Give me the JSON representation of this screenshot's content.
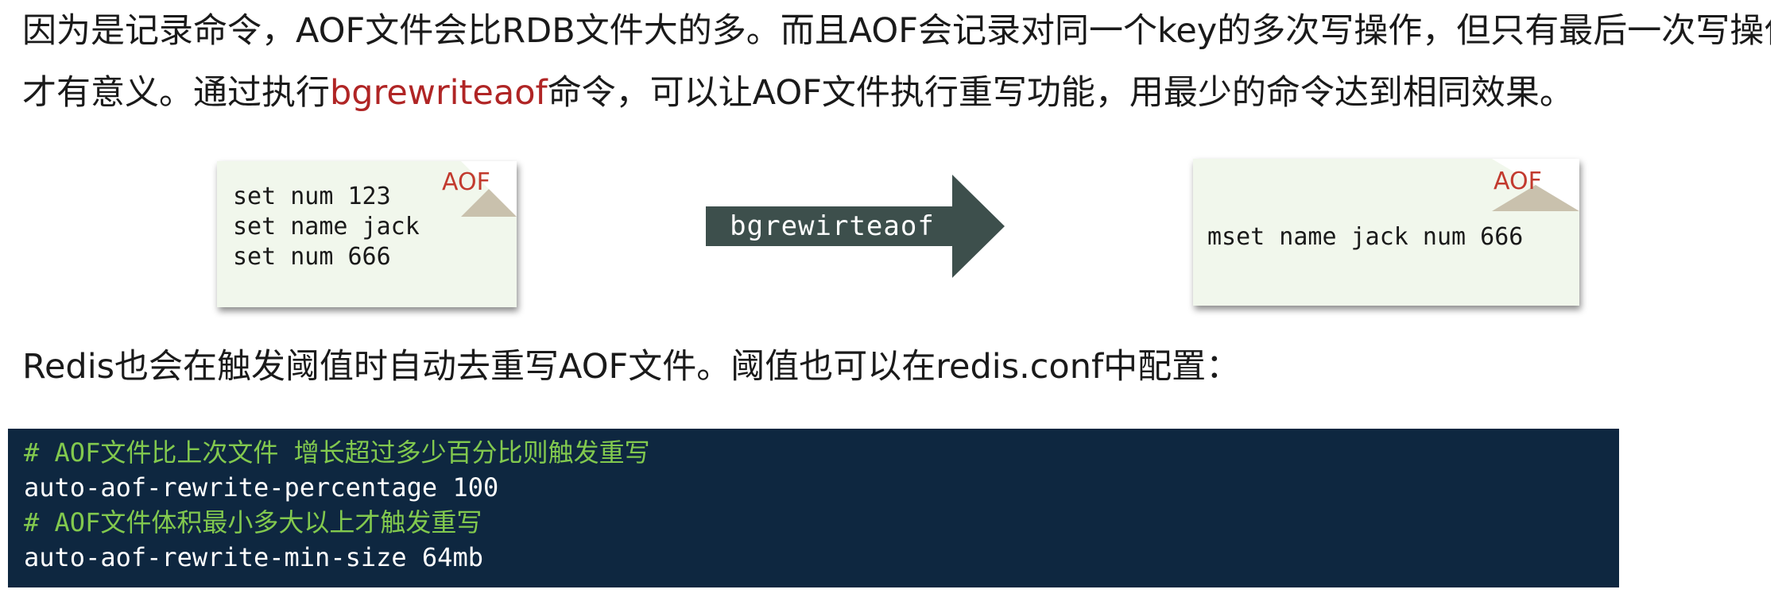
{
  "paragraph1": {
    "line1": "因为是记录命令，AOF文件会比RDB文件大的多。而且AOF会记录对同一个key的多次写操作，但只有最后一次写操作",
    "line2_before": "才有意义。通过执行",
    "line2_highlight": "bgrewriteaof",
    "line2_after": "命令，可以让AOF文件执行重写功能，用最少的命令达到相同效果。"
  },
  "diagram": {
    "left_note": {
      "tag": "AOF",
      "lines": [
        "set num 123",
        "set name jack",
        "set num 666"
      ]
    },
    "arrow_label": "bgrewirteaof",
    "right_note": {
      "tag": "AOF",
      "lines": [
        "mset name jack num 666"
      ]
    }
  },
  "paragraph2": "Redis也会在触发阈值时自动去重写AOF文件。阈值也可以在redis.conf中配置：",
  "code_block": {
    "lines": [
      {
        "text": "# AOF文件比上次文件 增长超过多少百分比则触发重写",
        "kind": "comment"
      },
      {
        "text": "auto-aof-rewrite-percentage 100",
        "kind": "plain"
      },
      {
        "text": "# AOF文件体积最小多大以上才触发重写",
        "kind": "comment"
      },
      {
        "text": "auto-aof-rewrite-min-size 64mb",
        "kind": "plain"
      }
    ]
  },
  "colors": {
    "highlight": "#b02525",
    "note_background": "#f1f7ec",
    "arrow": "#3d4f4c",
    "code_background": "#0e2740",
    "code_comment": "#82c94e"
  }
}
